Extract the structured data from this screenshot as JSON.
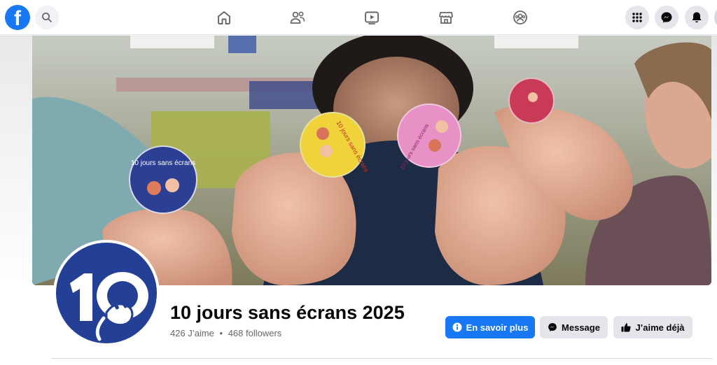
{
  "topbar": {
    "logo_letter": "f",
    "icons": {
      "logo": "facebook-logo",
      "search": "search-icon",
      "home": "home-icon",
      "friends": "friends-icon",
      "video": "video-icon",
      "marketplace": "marketplace-icon",
      "groups": "groups-icon",
      "menu": "grid-menu-icon",
      "messenger": "messenger-icon",
      "notifications": "bell-icon"
    }
  },
  "profile": {
    "avatar_text": "10",
    "name": "10 jours sans écrans 2025",
    "likes": "426 J’aime",
    "separator": "•",
    "followers": "468 followers"
  },
  "cover": {
    "badges": [
      "10 jours sans écrans",
      "10 jours sans écrans",
      "10 jours sans écrans"
    ]
  },
  "actions": {
    "learn_more": "En savoir plus",
    "message": "Message",
    "liked": "J’aime déjà"
  },
  "colors": {
    "brand": "#1877f2",
    "avatar_bg": "#233f96",
    "button_secondary": "#e4e6eb"
  }
}
